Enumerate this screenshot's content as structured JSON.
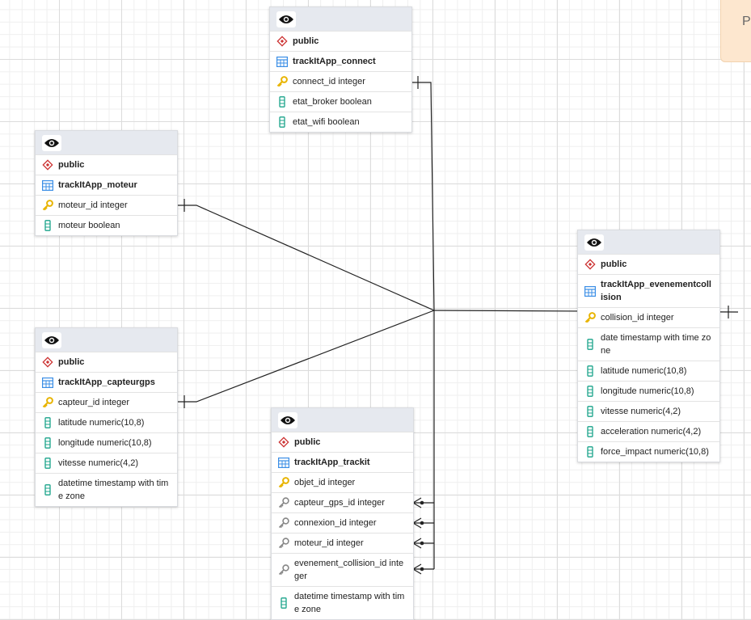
{
  "tables": [
    {
      "id": "connect",
      "schema": "public",
      "name": "trackItApp_connect",
      "columns": [
        {
          "text": "connect_id integer",
          "kind": "pk"
        },
        {
          "text": "etat_broker boolean",
          "kind": "col"
        },
        {
          "text": "etat_wifi boolean",
          "kind": "col"
        }
      ]
    },
    {
      "id": "moteur",
      "schema": "public",
      "name": "trackItApp_moteur",
      "columns": [
        {
          "text": "moteur_id integer",
          "kind": "pk"
        },
        {
          "text": "moteur boolean",
          "kind": "col"
        }
      ]
    },
    {
      "id": "capteurgps",
      "schema": "public",
      "name": "trackItApp_capteurgps",
      "columns": [
        {
          "text": "capteur_id integer",
          "kind": "pk"
        },
        {
          "text": "latitude numeric(10,8)",
          "kind": "col"
        },
        {
          "text": "longitude numeric(10,8)",
          "kind": "col"
        },
        {
          "text": "vitesse numeric(4,2)",
          "kind": "col"
        },
        {
          "text": "datetime timestamp with time zone",
          "kind": "col"
        }
      ]
    },
    {
      "id": "trackit",
      "schema": "public",
      "name": "trackItApp_trackit",
      "columns": [
        {
          "text": "objet_id integer",
          "kind": "pk"
        },
        {
          "text": "capteur_gps_id integer",
          "kind": "fk"
        },
        {
          "text": "connexion_id integer",
          "kind": "fk"
        },
        {
          "text": "moteur_id integer",
          "kind": "fk"
        },
        {
          "text": "evenement_collision_id integer",
          "kind": "fk"
        },
        {
          "text": "datetime timestamp with time zone",
          "kind": "col"
        }
      ]
    },
    {
      "id": "evenement",
      "schema": "public",
      "name": "trackItApp_evenementcollision",
      "columns": [
        {
          "text": "collision_id integer",
          "kind": "pk"
        },
        {
          "text": "date timestamp with time zone",
          "kind": "col"
        },
        {
          "text": "latitude numeric(10,8)",
          "kind": "col"
        },
        {
          "text": "longitude numeric(10,8)",
          "kind": "col"
        },
        {
          "text": "vitesse numeric(4,2)",
          "kind": "col"
        },
        {
          "text": "acceleration numeric(4,2)",
          "kind": "col"
        },
        {
          "text": "force_impact numeric(10,8)",
          "kind": "col"
        }
      ]
    }
  ],
  "note": {
    "text": "P"
  },
  "colors": {
    "pk_icon": "#e8b400",
    "fk_icon": "#888888",
    "col_icon": "#19a38a",
    "schema_icon": "#cc3333",
    "table_icon": "#3a8ee6",
    "link": "#222222"
  }
}
